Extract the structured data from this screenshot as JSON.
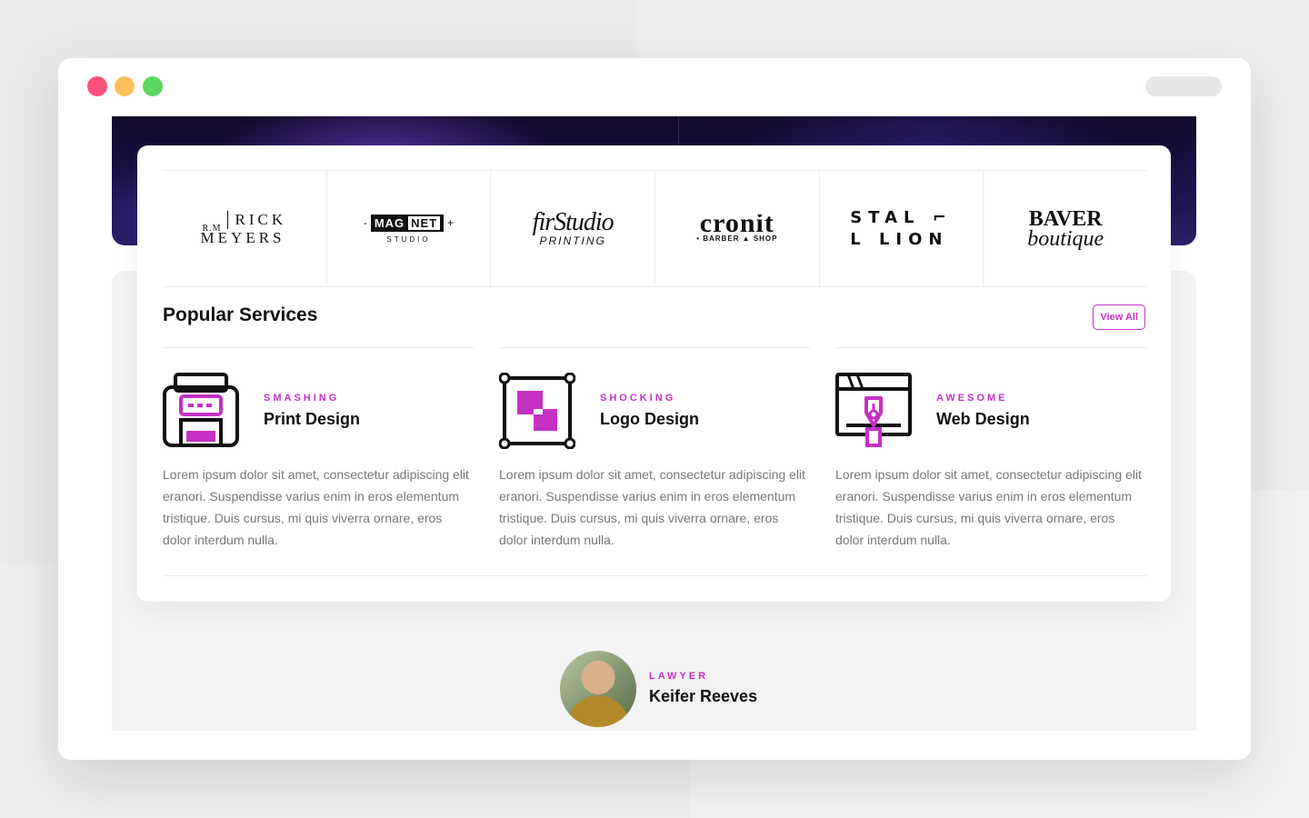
{
  "window": {
    "controls": [
      "close",
      "minimize",
      "maximize"
    ]
  },
  "logos": [
    {
      "id": "rick-meyers",
      "prefix": "R.M",
      "line1": "RICK",
      "line2": "MEYERS"
    },
    {
      "id": "magnet-studio",
      "part1": "MAG",
      "part2": "NET",
      "sub": "STUDIO"
    },
    {
      "id": "firstudio",
      "title": "firStudio",
      "sub": "PRINTING"
    },
    {
      "id": "cronit",
      "title": "cronit",
      "sub": "• BARBER ▲ SHOP"
    },
    {
      "id": "stal-lion",
      "line1": "STAL ⌐",
      "line2": "L LION"
    },
    {
      "id": "baver",
      "line1": "BAVER",
      "line2": "boutique"
    }
  ],
  "services_section": {
    "title": "Popular Services",
    "view_all_label": "View All",
    "items": [
      {
        "tag": "SMASHING",
        "name": "Print Design",
        "icon": "printer-icon",
        "description": "Lorem ipsum dolor sit amet, consectetur adipiscing elit eranori. Suspendisse varius enim in eros elementum tristique. Duis cursus, mi quis viverra ornare, eros dolor interdum nulla."
      },
      {
        "tag": "SHOCKING",
        "name": "Logo Design",
        "icon": "vector-shapes-icon",
        "description": "Lorem ipsum dolor sit amet, consectetur adipiscing elit eranori. Suspendisse varius enim in eros elementum tristique. Duis cursus, mi quis viverra ornare, eros dolor interdum nulla."
      },
      {
        "tag": "AWESOME",
        "name": "Web Design",
        "icon": "pen-tool-window-icon",
        "description": "Lorem ipsum dolor sit amet, consectetur adipiscing elit eranori. Suspendisse varius enim in eros elementum tristique. Duis cursus, mi quis viverra ornare, eros dolor interdum nulla."
      }
    ]
  },
  "testimonial": {
    "role": "LAWYER",
    "name": "Keifer Reeves"
  },
  "colors": {
    "accent": "#c530c5",
    "close": "#ff4f7b",
    "minimize": "#ffbe5c",
    "maximize": "#5bd75f"
  }
}
